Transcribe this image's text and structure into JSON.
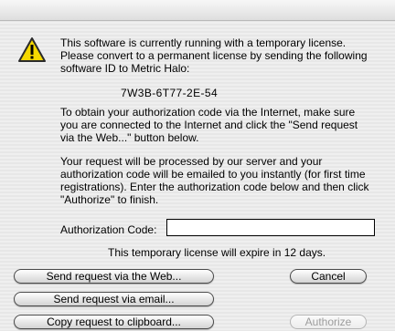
{
  "message": {
    "intro": "This software is currently running with a temporary license. Please convert to a permanent license by sending the following software ID to Metric Halo:",
    "software_id": "7W3B-6T77-2E-54",
    "internet": "To obtain your authorization code via the Internet, make sure you are connected to the Internet and click the \"Send request via the Web...\" button below.",
    "processing": "Your request will be processed by our  server and your authorization code will be emailed to you instantly (for first time registrations). Enter the authorization code below and then click \"Authorize\" to finish."
  },
  "form": {
    "auth_label": "Authorization Code:",
    "auth_value": "",
    "expire_notice": "This temporary license will expire in 12 days."
  },
  "buttons": {
    "send_web": "Send request via the Web...",
    "send_email": "Send request via email...",
    "copy_clipboard": "Copy request to clipboard...",
    "cancel": "Cancel",
    "authorize": "Authorize"
  },
  "icons": {
    "warning": "warning-icon"
  },
  "colors": {
    "warning_yellow": "#f5d800",
    "disabled_text": "#9c9c9c"
  }
}
